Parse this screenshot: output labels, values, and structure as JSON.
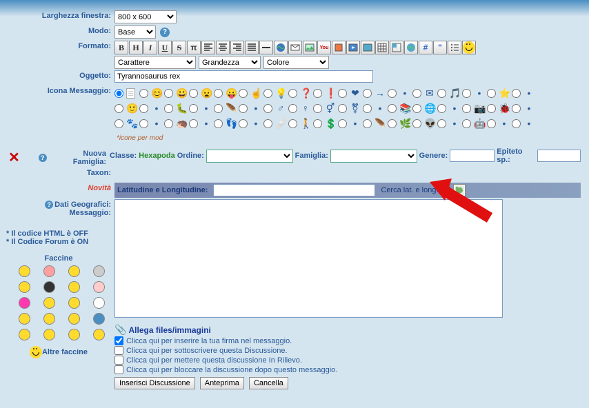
{
  "labels": {
    "larghezza": "Larghezza finestra:",
    "modo": "Modo:",
    "formato": "Formato:",
    "oggetto": "Oggetto:",
    "icona_msg": "Icona Messaggio:",
    "nuova_fam": "Nuova Famiglia:",
    "taxon": "Taxon:",
    "novita": "Novità",
    "dati_geo": "Dati Geografici:",
    "messaggio": "Messaggio:"
  },
  "selects": {
    "window_size": "800 x 600",
    "mode": "Base",
    "char": "Carattere",
    "size": "Grandezza",
    "color": "Colore"
  },
  "subject_value": "Tyrannosaurus rex",
  "toolbar": [
    "B",
    "H",
    "I",
    "U",
    "S",
    "π"
  ],
  "taxon": {
    "classe_label": "Classe:",
    "classe_value": "Hexapoda",
    "ordine_label": "Ordine:",
    "famiglia_label": "Famiglia:",
    "genere_label": "Genere:",
    "epiteto_label": "Epiteto sp.:"
  },
  "geo": {
    "latlon_label": "Latitudine e Longitudine:",
    "search_label": "Cerca lat. e long. qui"
  },
  "icone_mod": "*icone per mod",
  "sidebar": {
    "html_off": "* Il codice HTML è OFF",
    "forum_on": "* Il Codice Forum è ON",
    "faccine": "Faccine",
    "altre": "Altre faccine"
  },
  "attach": {
    "title": "Allega files/immagini",
    "chk1": "Clicca qui per inserire la tua firma nel messaggio.",
    "chk2": "Clicca qui per sottoscrivere questa Discussione.",
    "chk3": "Clicca qui per mettere questa discussione In Rilievo.",
    "chk4": "Clicca qui per bloccare la discussione dopo questo messaggio."
  },
  "buttons": {
    "insert": "Inserisci Discussione",
    "preview": "Anteprima",
    "cancel": "Cancella"
  },
  "message_icons_count": 51,
  "faccine_colors": [
    "#ffdb2e",
    "#ffa0a0",
    "#ffdb2e",
    "#ccc",
    "#ffdb2e",
    "#333",
    "#ffdb2e",
    "#ffcccc",
    "#ff3ab0",
    "#ffdb2e",
    "#ffdb2e",
    "#fff",
    "#ffdb2e",
    "#ffdb2e",
    "#ffdb2e",
    "#4a8ec2",
    "#ffdb2e",
    "#ffdb2e",
    "#ffdb2e",
    "#ffdb2e"
  ]
}
